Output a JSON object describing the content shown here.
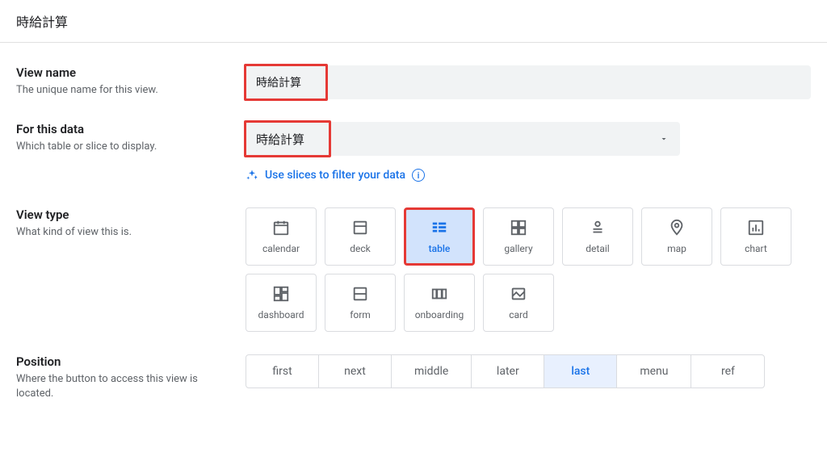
{
  "header": {
    "title": "時給計算"
  },
  "fields": {
    "viewName": {
      "label": "View name",
      "desc": "The unique name for this view.",
      "value": "時給計算"
    },
    "forData": {
      "label": "For this data",
      "desc": "Which table or slice to display.",
      "value": "時給計算",
      "helperLink": "Use slices to filter your data"
    },
    "viewType": {
      "label": "View type",
      "desc": "What kind of view this is.",
      "tiles": [
        {
          "key": "calendar",
          "label": "calendar",
          "selected": false
        },
        {
          "key": "deck",
          "label": "deck",
          "selected": false
        },
        {
          "key": "table",
          "label": "table",
          "selected": true
        },
        {
          "key": "gallery",
          "label": "gallery",
          "selected": false
        },
        {
          "key": "detail",
          "label": "detail",
          "selected": false
        },
        {
          "key": "map",
          "label": "map",
          "selected": false
        },
        {
          "key": "chart",
          "label": "chart",
          "selected": false
        },
        {
          "key": "dashboard",
          "label": "dashboard",
          "selected": false
        },
        {
          "key": "form",
          "label": "form",
          "selected": false
        },
        {
          "key": "onboarding",
          "label": "onboarding",
          "selected": false
        },
        {
          "key": "card",
          "label": "card",
          "selected": false
        }
      ]
    },
    "position": {
      "label": "Position",
      "desc": "Where the button to access this view is located.",
      "options": [
        {
          "key": "first",
          "label": "first",
          "selected": false
        },
        {
          "key": "next",
          "label": "next",
          "selected": false
        },
        {
          "key": "middle",
          "label": "middle",
          "selected": false
        },
        {
          "key": "later",
          "label": "later",
          "selected": false
        },
        {
          "key": "last",
          "label": "last",
          "selected": true
        },
        {
          "key": "menu",
          "label": "menu",
          "selected": false
        },
        {
          "key": "ref",
          "label": "ref",
          "selected": false
        }
      ]
    }
  },
  "icons": {
    "calendar": "calendar-icon",
    "deck": "deck-icon",
    "table": "table-icon",
    "gallery": "gallery-icon",
    "detail": "detail-icon",
    "map": "map-icon",
    "chart": "chart-icon",
    "dashboard": "dashboard-icon",
    "form": "form-icon",
    "onboarding": "onboarding-icon",
    "card": "card-icon"
  }
}
